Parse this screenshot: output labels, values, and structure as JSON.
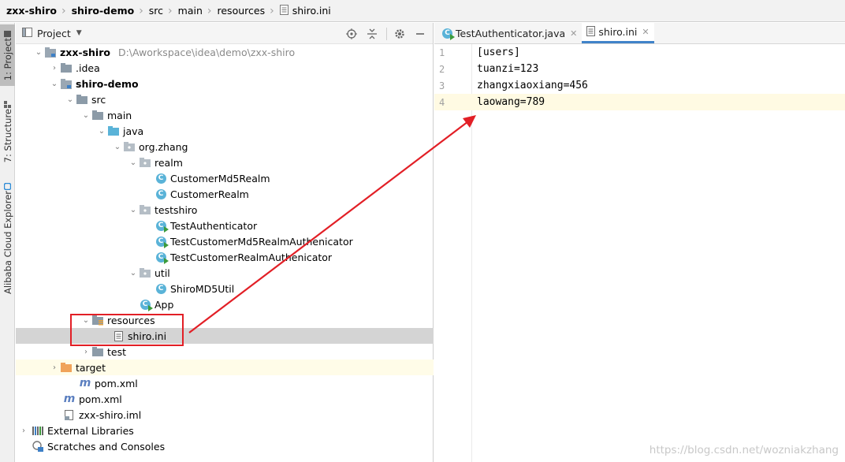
{
  "breadcrumb": [
    {
      "label": "zxx-shiro",
      "bold": true
    },
    {
      "label": "shiro-demo",
      "bold": true
    },
    {
      "label": "src",
      "bold": false
    },
    {
      "label": "main",
      "bold": false
    },
    {
      "label": "resources",
      "bold": false
    },
    {
      "label": "shiro.ini",
      "bold": false
    }
  ],
  "side_stripe": {
    "project": "1: Project",
    "structure": "7: Structure",
    "alibaba": "Alibaba Cloud Explorer"
  },
  "project_panel": {
    "title": "Project",
    "tools": [
      "locate-icon",
      "collapse-icon",
      "gear-icon",
      "hide-icon"
    ]
  },
  "tree": {
    "root": {
      "label": "zxx-shiro",
      "path": "D:\\Aworkspace\\idea\\demo\\zxx-shiro"
    },
    "idea": ".idea",
    "shiro_demo": "shiro-demo",
    "src": "src",
    "main": "main",
    "java": "java",
    "org_zhang": "org.zhang",
    "realm": "realm",
    "customer_md5_realm": "CustomerMd5Realm",
    "customer_realm": "CustomerRealm",
    "testshiro": "testshiro",
    "test_authenticator": "TestAuthenticator",
    "test_customer_md5": "TestCustomerMd5RealmAuthenicator",
    "test_customer_realm": "TestCustomerRealmAuthenicator",
    "util": "util",
    "shiro_md5_util": "ShiroMD5Util",
    "app": "App",
    "resources": "resources",
    "shiro_ini": "shiro.ini",
    "test": "test",
    "target": "target",
    "pom_inner": "pom.xml",
    "pom_outer": "pom.xml",
    "iml": "zxx-shiro.iml",
    "external_libraries": "External Libraries",
    "scratches": "Scratches and Consoles"
  },
  "editor": {
    "tabs": [
      {
        "label": "TestAuthenticator.java",
        "active": false
      },
      {
        "label": "shiro.ini",
        "active": true
      }
    ],
    "lines": [
      {
        "num": "1",
        "text": "[users]"
      },
      {
        "num": "2",
        "text": "tuanzi=123"
      },
      {
        "num": "3",
        "text": "zhangxiaoxiang=456"
      },
      {
        "num": "4",
        "text": "laowang=789"
      }
    ],
    "current_line": 4
  },
  "watermark": "https://blog.csdn.net/wozniakzhang",
  "colors": {
    "annotation": "#e21f26",
    "folder": "#8c9ba8",
    "excluded_folder": "#f0a35a",
    "class_icon": "#5ab3d8",
    "tab_underline": "#4083c9"
  }
}
